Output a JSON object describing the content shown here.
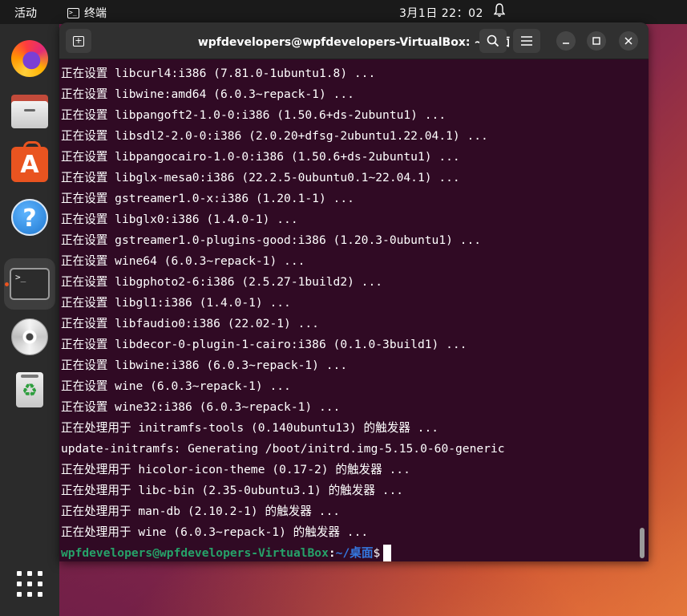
{
  "topbar": {
    "activities": "活动",
    "app_name": "终端",
    "clock": "3月1日  22：02",
    "term_glyph": ">_"
  },
  "dock": {
    "items": [
      "firefox",
      "files",
      "app-center",
      "help",
      "terminal",
      "disc",
      "trash"
    ],
    "terminal_glyph": ">_",
    "appstore_glyph": "A",
    "help_glyph": "?",
    "trash_glyph": "♻"
  },
  "window": {
    "title": "wpfdevelopers@wpfdevelopers-VirtualBox: ~/桌面",
    "min_glyph": "—",
    "max_glyph": "☐",
    "close_glyph": "✕",
    "search_glyph": "⌕",
    "menu_glyph": "☰",
    "newtab_glyph": "+"
  },
  "terminal": {
    "lines": [
      "正在设置 libcurl4:i386 (7.81.0-1ubuntu1.8) ...",
      "正在设置 libwine:amd64 (6.0.3~repack-1) ...",
      "正在设置 libpangoft2-1.0-0:i386 (1.50.6+ds-2ubuntu1) ...",
      "正在设置 libsdl2-2.0-0:i386 (2.0.20+dfsg-2ubuntu1.22.04.1) ...",
      "正在设置 libpangocairo-1.0-0:i386 (1.50.6+ds-2ubuntu1) ...",
      "正在设置 libglx-mesa0:i386 (22.2.5-0ubuntu0.1~22.04.1) ...",
      "正在设置 gstreamer1.0-x:i386 (1.20.1-1) ...",
      "正在设置 libglx0:i386 (1.4.0-1) ...",
      "正在设置 gstreamer1.0-plugins-good:i386 (1.20.3-0ubuntu1) ...",
      "正在设置 wine64 (6.0.3~repack-1) ...",
      "正在设置 libgphoto2-6:i386 (2.5.27-1build2) ...",
      "正在设置 libgl1:i386 (1.4.0-1) ...",
      "正在设置 libfaudio0:i386 (22.02-1) ...",
      "正在设置 libdecor-0-plugin-1-cairo:i386 (0.1.0-3build1) ...",
      "正在设置 libwine:i386 (6.0.3~repack-1) ...",
      "正在设置 wine (6.0.3~repack-1) ...",
      "正在设置 wine32:i386 (6.0.3~repack-1) ...",
      "正在处理用于 initramfs-tools (0.140ubuntu13) 的触发器 ...",
      "update-initramfs: Generating /boot/initrd.img-5.15.0-60-generic",
      "正在处理用于 hicolor-icon-theme (0.17-2) 的触发器 ...",
      "正在处理用于 libc-bin (2.35-0ubuntu3.1) 的触发器 ...",
      "正在处理用于 man-db (2.10.2-1) 的触发器 ...",
      "正在处理用于 wine (6.0.3~repack-1) 的触发器 ..."
    ],
    "prompt_user": "wpfdevelopers@wpfdevelopers-VirtualBox",
    "prompt_sep": ":",
    "prompt_path": "~/桌面",
    "prompt_dollar": "$"
  }
}
